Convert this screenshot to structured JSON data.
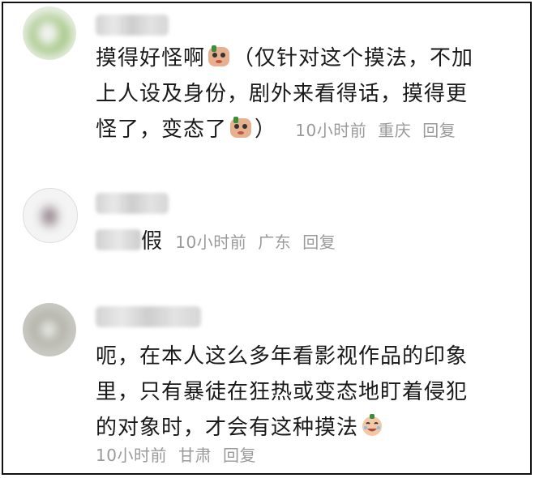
{
  "comments": [
    {
      "avatar_icon": "blurred-avatar-green",
      "lines": [
        "摸得好怪啊",
        "（仅针对这个摸法，不加",
        "上人设及身份，剧外来看得话，摸得更",
        "怪了，变态了",
        "）"
      ],
      "meta": {
        "time": "10小时前",
        "location": "重庆",
        "reply": "回复"
      }
    },
    {
      "avatar_icon": "blurred-avatar-white",
      "text": "假",
      "meta": {
        "time": "10小时前",
        "location": "广东",
        "reply": "回复"
      }
    },
    {
      "avatar_icon": "blurred-avatar-gray",
      "lines": [
        "呃，在本人这么多年看影视作品的印象",
        "里，只有暴徒在狂热或变态地盯着侵犯",
        "的对象时，才会有这种摸法"
      ],
      "meta": {
        "time": "10小时前",
        "location": "甘肃",
        "reply": "回复"
      }
    }
  ],
  "colors": {
    "text": "#1a1a1a",
    "meta": "#9a9a9a",
    "border": "#111111"
  }
}
